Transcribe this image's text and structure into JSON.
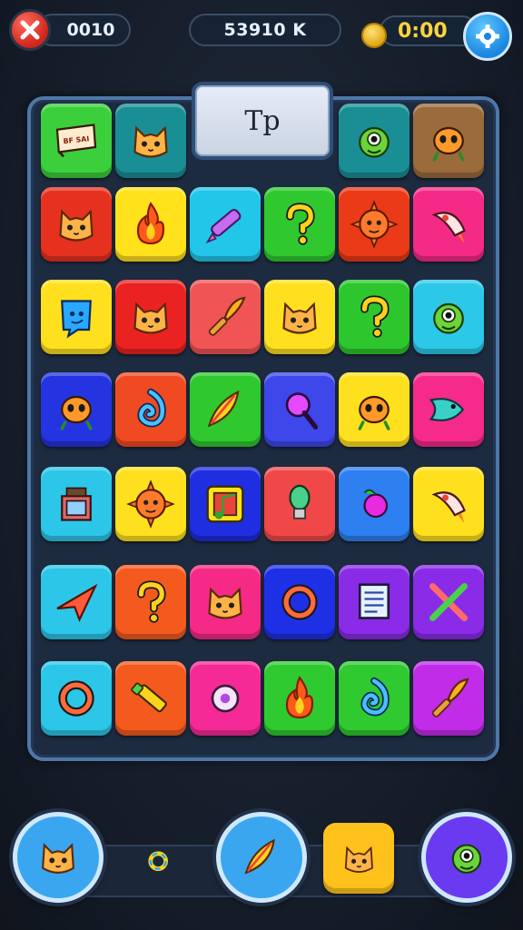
{
  "hud": {
    "left_value": "0010",
    "score": "53910 K",
    "timer": "0:00",
    "icons": {
      "close": "close-icon",
      "coin": "coin-icon",
      "settings": "gear-icon"
    }
  },
  "tip": {
    "label": "Tp"
  },
  "board": {
    "rows": [
      [
        {
          "color": "#3bcf3b",
          "icon": "sign-icon",
          "sign_text": "BF SAI"
        },
        {
          "color": "#1a8e95",
          "icon": "cat-icon"
        },
        null,
        null,
        {
          "color": "#1a8e95",
          "icon": "monster-icon"
        },
        {
          "color": "#9b6b3c",
          "icon": "alien-icon"
        }
      ],
      [
        {
          "color": "#e6311f",
          "icon": "cat-icon"
        },
        {
          "color": "#ffe21c",
          "icon": "fire-icon"
        },
        {
          "color": "#22c6e8",
          "icon": "pen-icon"
        },
        {
          "color": "#2fc92f",
          "icon": "question-icon"
        },
        {
          "color": "#ea3a17",
          "icon": "sun-face-icon"
        },
        {
          "color": "#f52a86",
          "icon": "rocket-icon"
        }
      ],
      [
        {
          "color": "#ffe01e",
          "icon": "ghost-icon"
        },
        {
          "color": "#ea2222",
          "icon": "cat-icon"
        },
        {
          "color": "#f05454",
          "icon": "brush-icon"
        },
        {
          "color": "#ffe01e",
          "icon": "cat-icon"
        },
        {
          "color": "#2dc72d",
          "icon": "question-icon"
        },
        {
          "color": "#2bc8e8",
          "icon": "monster-icon"
        }
      ],
      [
        {
          "color": "#2334e0",
          "icon": "alien-icon"
        },
        {
          "color": "#f04a22",
          "icon": "spiral-icon"
        },
        {
          "color": "#2fc82f",
          "icon": "feather-icon"
        },
        {
          "color": "#3e47ea",
          "icon": "magnifier-icon"
        },
        {
          "color": "#ffe01e",
          "icon": "alien-icon"
        },
        {
          "color": "#f52a8a",
          "icon": "fish-icon"
        }
      ],
      [
        {
          "color": "#2cc6e8",
          "icon": "box-icon"
        },
        {
          "color": "#ffe01e",
          "icon": "sun-face-icon"
        },
        {
          "color": "#1e2ee0",
          "icon": "music-icon"
        },
        {
          "color": "#f04848",
          "icon": "bulb-icon"
        },
        {
          "color": "#2e7ff0",
          "icon": "berry-icon"
        },
        {
          "color": "#ffe01e",
          "icon": "rocket-icon"
        }
      ],
      [
        {
          "color": "#2cc6e8",
          "icon": "plane-icon"
        },
        {
          "color": "#f45a1e",
          "icon": "question-icon"
        },
        {
          "color": "#f52a86",
          "icon": "cat-icon"
        },
        {
          "color": "#1e30e6",
          "icon": "ring-icon"
        },
        {
          "color": "#8a2be8",
          "icon": "note-icon"
        },
        {
          "color": "#8a2be8",
          "icon": "crossed-icon"
        }
      ],
      [
        {
          "color": "#2cc6e8",
          "icon": "ring-icon"
        },
        {
          "color": "#f45a1e",
          "icon": "crayon-icon"
        },
        {
          "color": "#f52a96",
          "icon": "disc-icon"
        },
        {
          "color": "#2fca2f",
          "icon": "fire-icon"
        },
        {
          "color": "#2fca2f",
          "icon": "spiral-icon"
        },
        {
          "color": "#c02ce8",
          "icon": "brush-icon"
        }
      ]
    ]
  },
  "dock": {
    "buttons": [
      {
        "icon": "cat-icon",
        "bg": "#3aa6f0"
      },
      {
        "icon": "gear-icon",
        "bg": "none"
      },
      {
        "icon": "feather-icon",
        "bg": "#3aa6f0"
      },
      {
        "icon": "cat-icon",
        "bg": "#ffc21c"
      },
      {
        "icon": "monster-icon",
        "bg": "#6a3af0"
      }
    ]
  }
}
